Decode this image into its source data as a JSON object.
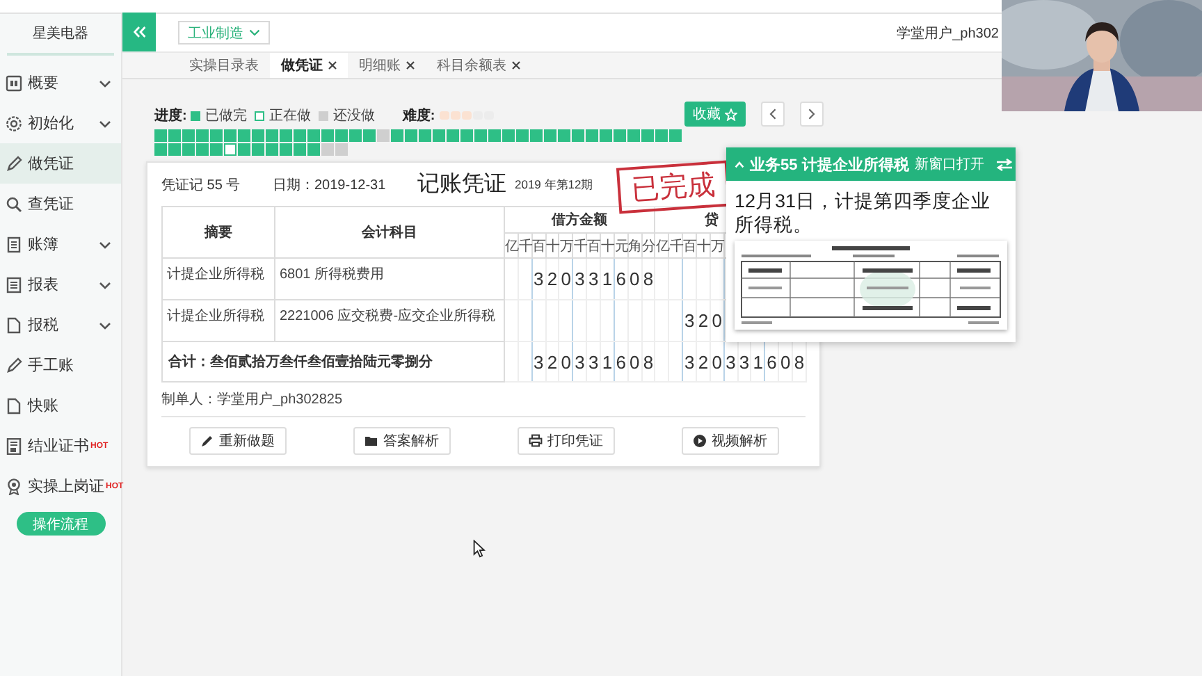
{
  "sidebar": {
    "brand": "星美电器",
    "items": [
      {
        "label": "概要",
        "expandable": true,
        "selected": false
      },
      {
        "label": "初始化",
        "expandable": true,
        "selected": false
      },
      {
        "label": "做凭证",
        "expandable": false,
        "selected": true
      },
      {
        "label": "查凭证",
        "expandable": false,
        "selected": false
      },
      {
        "label": "账簿",
        "expandable": true,
        "selected": false
      },
      {
        "label": "报表",
        "expandable": true,
        "selected": false
      },
      {
        "label": "报税",
        "expandable": true,
        "selected": false
      },
      {
        "label": "手工账",
        "expandable": false,
        "selected": false
      },
      {
        "label": "快账",
        "expandable": false,
        "selected": false
      },
      {
        "label": "结业证书",
        "expandable": false,
        "selected": false,
        "badge": "HOT"
      },
      {
        "label": "实操上岗证",
        "expandable": false,
        "selected": false,
        "badge": "HOT"
      }
    ],
    "button": "操作流程"
  },
  "topbar": {
    "industry": "工业制造",
    "user": "学堂用户_ph302"
  },
  "tabs": [
    {
      "label": "实操目录表",
      "closable": false,
      "selected": false
    },
    {
      "label": "做凭证",
      "closable": true,
      "selected": true
    },
    {
      "label": "明细账",
      "closable": true,
      "selected": false
    },
    {
      "label": "科目余额表",
      "closable": true,
      "selected": false
    }
  ],
  "progress": {
    "label": "进度:",
    "legend": [
      {
        "kind": "done",
        "label": "已做完"
      },
      {
        "kind": "current",
        "label": "正在做"
      },
      {
        "kind": "todo",
        "label": "还没做"
      }
    ],
    "difficulty_label": "难度:",
    "stars": 3,
    "cell_rows": [
      [
        {
          "kind": "done"
        },
        {
          "kind": "done"
        },
        {
          "kind": "done"
        },
        {
          "kind": "done"
        },
        {
          "kind": "done"
        },
        {
          "kind": "done"
        },
        {
          "kind": "done"
        },
        {
          "kind": "done"
        },
        {
          "kind": "done"
        },
        {
          "kind": "done"
        },
        {
          "kind": "done"
        },
        {
          "kind": "done"
        },
        {
          "kind": "done"
        },
        {
          "kind": "done"
        },
        {
          "kind": "done"
        },
        {
          "kind": "done"
        },
        {
          "kind": "todo"
        },
        {
          "kind": "done"
        },
        {
          "kind": "done"
        },
        {
          "kind": "done"
        },
        {
          "kind": "done"
        },
        {
          "kind": "done"
        },
        {
          "kind": "done"
        },
        {
          "kind": "done"
        },
        {
          "kind": "done"
        },
        {
          "kind": "done"
        },
        {
          "kind": "done"
        },
        {
          "kind": "done"
        },
        {
          "kind": "done"
        },
        {
          "kind": "done"
        },
        {
          "kind": "done"
        },
        {
          "kind": "done"
        },
        {
          "kind": "done"
        },
        {
          "kind": "done"
        },
        {
          "kind": "done"
        },
        {
          "kind": "done"
        },
        {
          "kind": "done"
        },
        {
          "kind": "done"
        }
      ],
      [
        {
          "kind": "done"
        },
        {
          "kind": "done"
        },
        {
          "kind": "done"
        },
        {
          "kind": "done"
        },
        {
          "kind": "done"
        },
        {
          "kind": "current"
        },
        {
          "kind": "done"
        },
        {
          "kind": "done"
        },
        {
          "kind": "done"
        },
        {
          "kind": "done"
        },
        {
          "kind": "done"
        },
        {
          "kind": "done"
        },
        {
          "kind": "todo"
        },
        {
          "kind": "todo"
        }
      ]
    ]
  },
  "favorite": "收藏",
  "voucher": {
    "number": "凭证记 55 号",
    "date": "日期：2019-12-31",
    "title": "记账凭证",
    "period": "2019 年第12期",
    "stamp": "已完成",
    "columns": {
      "summary": "摘要",
      "account": "会计科目",
      "debit": "借方金额",
      "credit": "贷",
      "debit_units": [
        "亿",
        "千",
        "百",
        "十",
        "万",
        "千",
        "百",
        "十",
        "元",
        "角",
        "分"
      ],
      "credit_units": [
        "亿",
        "千",
        "百",
        "十",
        "万"
      ]
    },
    "rows": [
      {
        "summary": "计提企业所得税",
        "account": "6801 所得税费用",
        "debit": "320331608"
      },
      {
        "summary": "计提企业所得税",
        "account": "2221006 应交税费-应交企业所得税",
        "credit": "320",
        "credit_cut": true
      }
    ],
    "total": {
      "label": "合计：叁佰贰拾万叁仟叁佰壹拾陆元零捌分",
      "debit": "320331608",
      "credit": "320331608"
    },
    "preparer": "制单人：学堂用户_ph302825",
    "buttons": [
      "重新做题",
      "答案解析",
      "打印凭证",
      "视频解析"
    ]
  },
  "task": {
    "title": "业务55 计提企业所得税",
    "open_new": "新窗口打开",
    "text": "12月31日，计提第四季度企业所得税。"
  }
}
